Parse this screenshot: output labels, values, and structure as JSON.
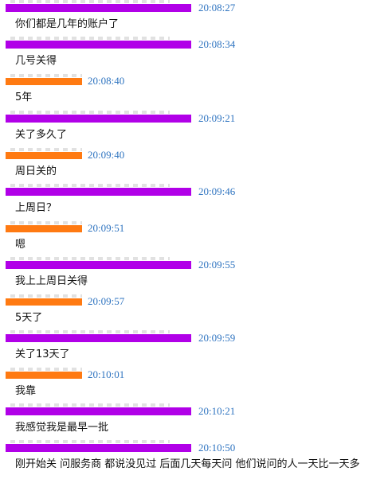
{
  "chat": {
    "messages": [
      {
        "sender_color": "purple",
        "time": "20:08:27",
        "text": "你们都是几年的账户了"
      },
      {
        "sender_color": "purple",
        "time": "20:08:34",
        "text": "几号关得"
      },
      {
        "sender_color": "orange",
        "time": "20:08:40",
        "text": "5年"
      },
      {
        "sender_color": "purple",
        "time": "20:09:21",
        "text": "关了多久了"
      },
      {
        "sender_color": "orange",
        "time": "20:09:40",
        "text": "周日关的"
      },
      {
        "sender_color": "purple",
        "time": "20:09:46",
        "text": "上周日？"
      },
      {
        "sender_color": "orange",
        "time": "20:09:51",
        "text": "嗯"
      },
      {
        "sender_color": "purple",
        "time": "20:09:55",
        "text": "我上上周日关得"
      },
      {
        "sender_color": "orange",
        "time": "20:09:57",
        "text": "5天了"
      },
      {
        "sender_color": "purple",
        "time": "20:09:59",
        "text": "关了13天了"
      },
      {
        "sender_color": "orange",
        "time": "20:10:01",
        "text": "我靠"
      },
      {
        "sender_color": "purple",
        "time": "20:10:21",
        "text": "我感觉我是最早一批"
      },
      {
        "sender_color": "purple",
        "time": "20:10:50",
        "text": "刚开始关  问服务商  都说没见过  后面几天每天问  他们说问的人一天比一天多"
      }
    ]
  },
  "colors": {
    "purple_redaction": "#b100e8",
    "orange_redaction": "#ff7a12",
    "timestamp": "#2f74c0",
    "message_text": "#111111"
  }
}
